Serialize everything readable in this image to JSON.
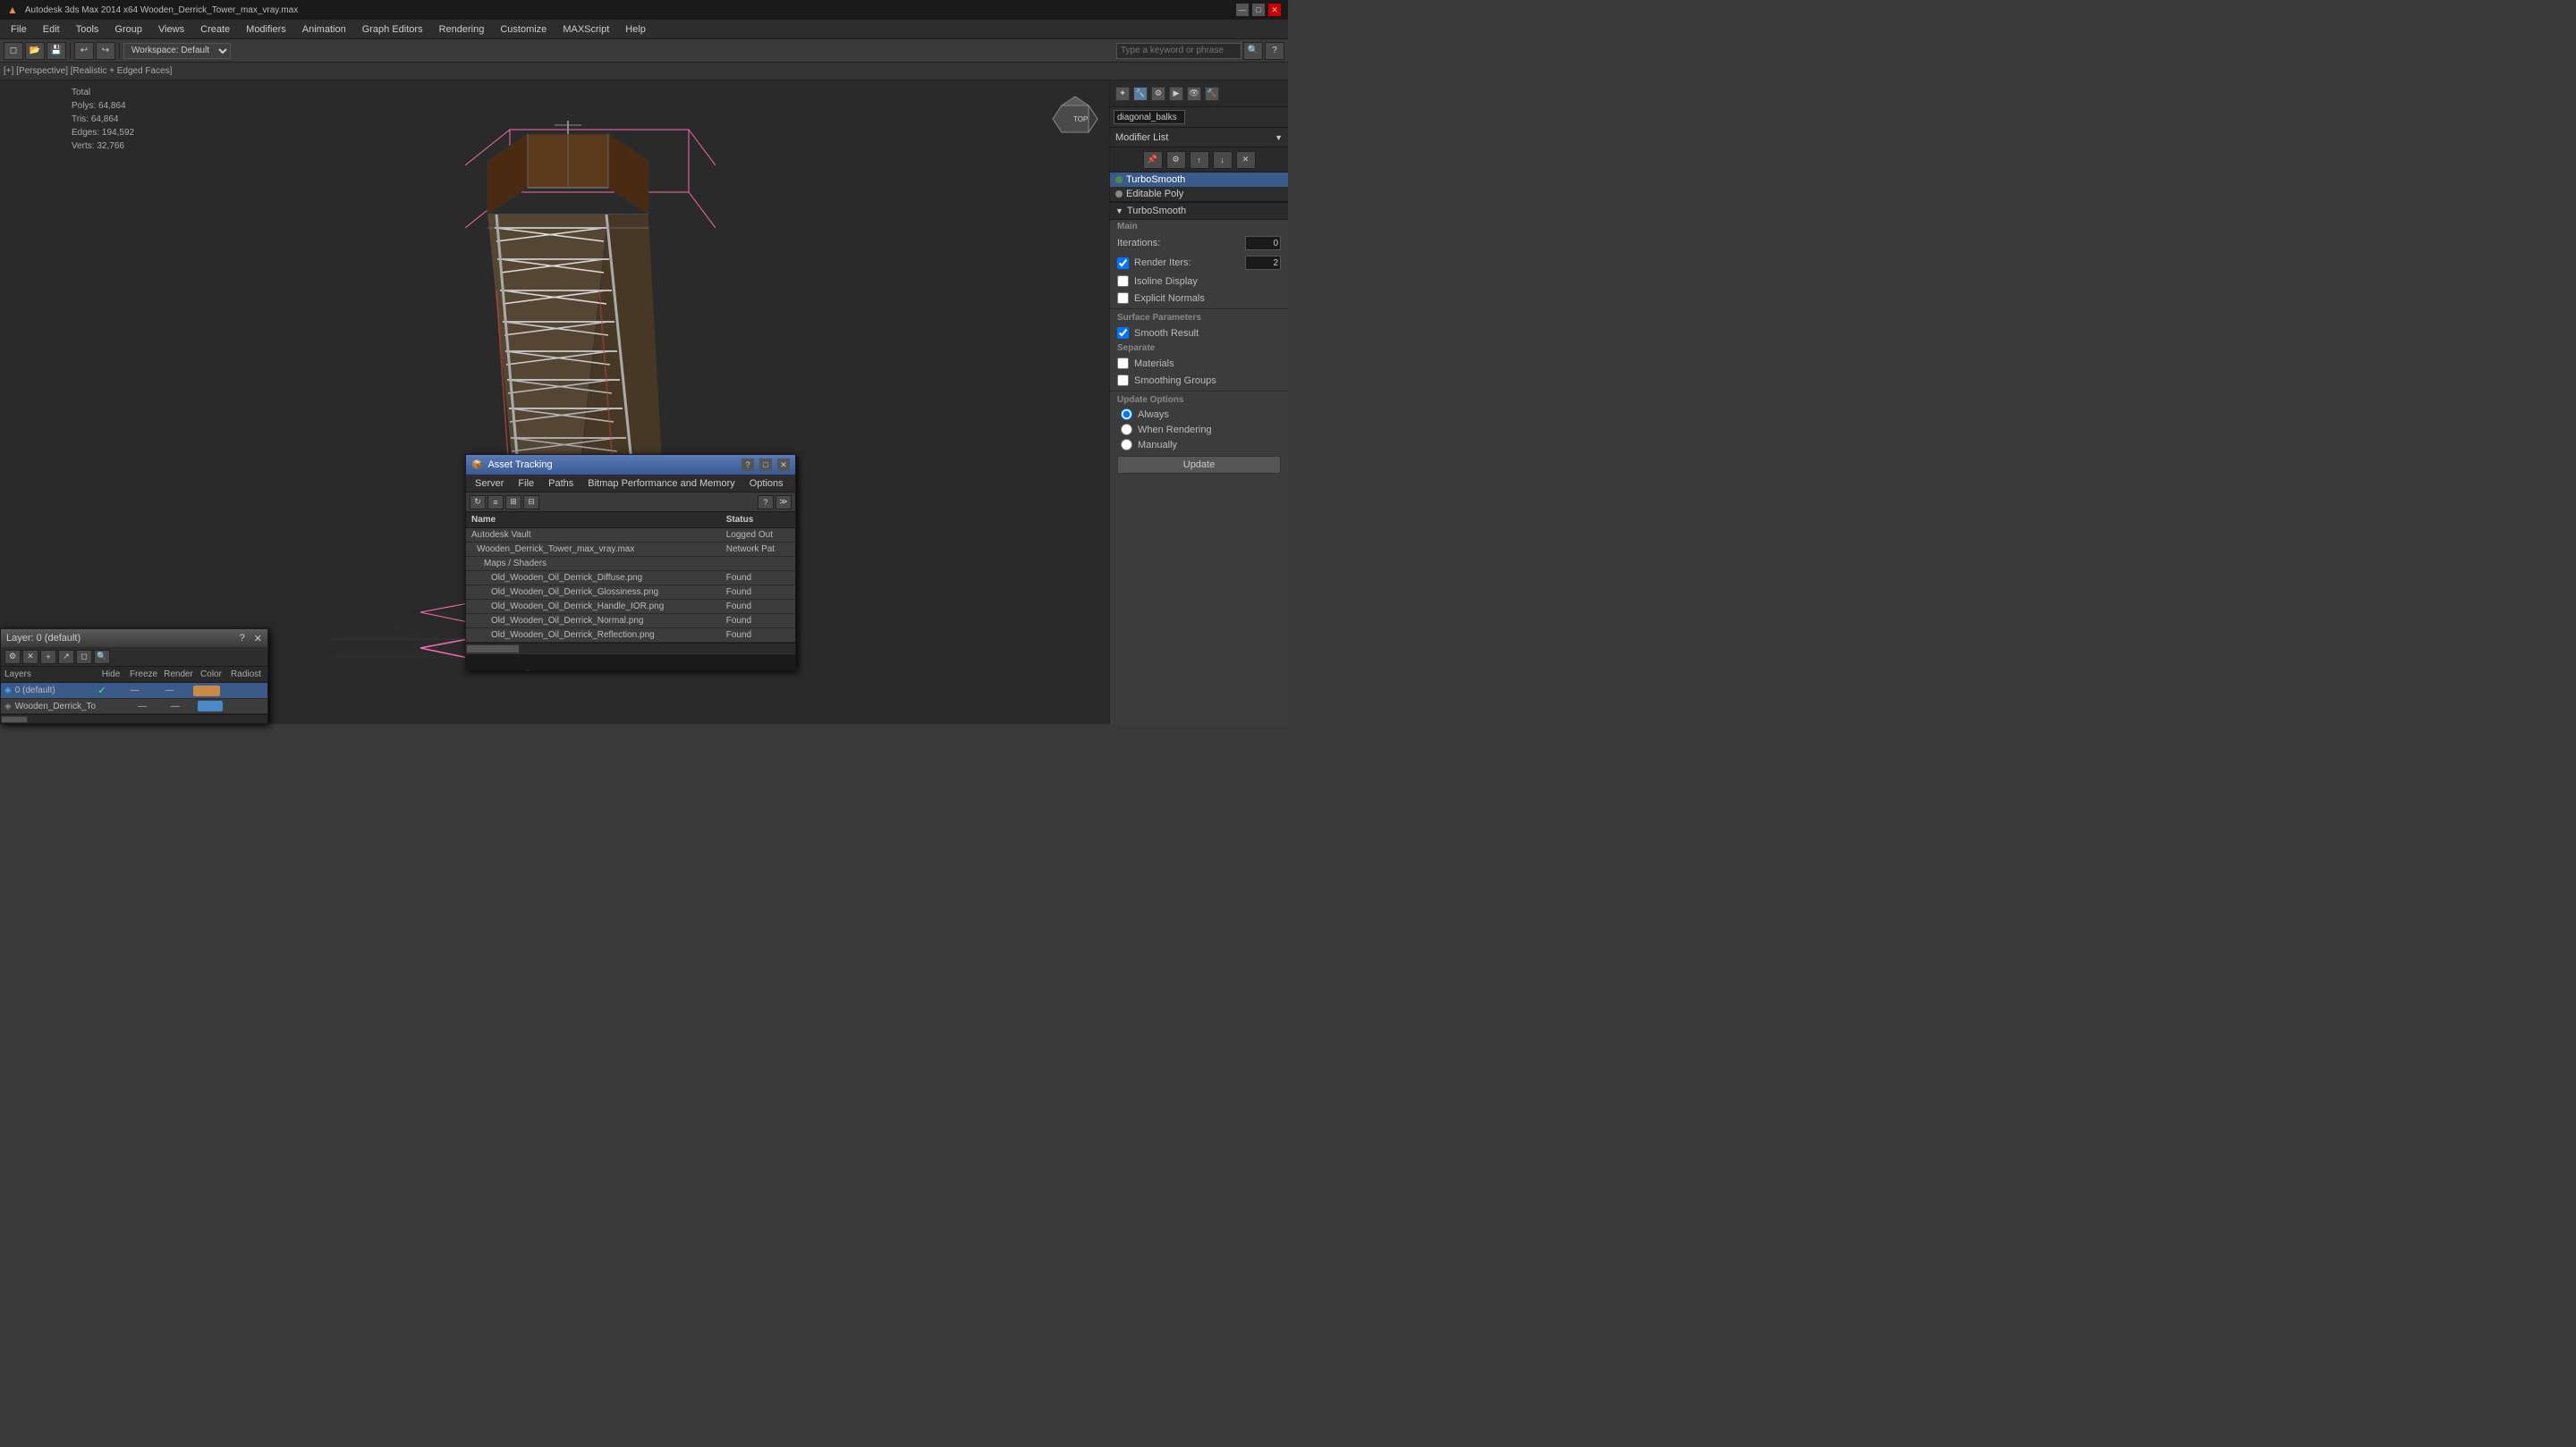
{
  "titlebar": {
    "app_icon": "3dsmax-icon",
    "title": "Autodesk 3ds Max 2014 x64  Wooden_Derrick_Tower_max_vray.max",
    "minimize_label": "—",
    "maximize_label": "□",
    "close_label": "✕"
  },
  "menubar": {
    "items": [
      "File",
      "Edit",
      "Tools",
      "Group",
      "Views",
      "Create",
      "Modifiers",
      "Animation",
      "Graph Editors",
      "Rendering",
      "Customize",
      "MAXScript",
      "Help"
    ]
  },
  "toolbar": {
    "workspace_label": "Workspace: Default",
    "search_placeholder": "Type a keyword or phrase"
  },
  "subtoolbar": {
    "breadcrumb": "[+] [Perspective] [Realistic + Edged Faces]"
  },
  "viewport": {
    "stats": {
      "total_label": "Total",
      "polys_label": "Polys:",
      "polys_value": "64,864",
      "tris_label": "Tris:",
      "tris_value": "64,864",
      "edges_label": "Edges:",
      "edges_value": "194,592",
      "verts_label": "Verts:",
      "verts_value": "32,766"
    }
  },
  "right_panel": {
    "name_field_value": "diagonal_balks",
    "modifier_list_label": "Modifier List",
    "modifiers": [
      {
        "name": "TurboSmooth",
        "active": true
      },
      {
        "name": "Editable Poly",
        "active": false
      }
    ],
    "turbosmooth": {
      "section_label": "TurboSmooth",
      "main_label": "Main",
      "iterations_label": "Iterations:",
      "iterations_value": "0",
      "render_iters_label": "Render Iters:",
      "render_iters_value": "2",
      "isoline_display_label": "Isoline Display",
      "explicit_normals_label": "Explicit Normals",
      "surface_params_label": "Surface Parameters",
      "smooth_result_label": "Smooth Result",
      "separate_label": "Separate",
      "materials_label": "Materials",
      "smoothing_groups_label": "Smoothing Groups",
      "update_options_label": "Update Options",
      "always_label": "Always",
      "when_rendering_label": "When Rendering",
      "manually_label": "Manually",
      "update_button_label": "Update"
    }
  },
  "asset_tracking": {
    "title": "Asset Tracking",
    "menu_items": [
      "Server",
      "File",
      "Paths",
      "Bitmap Performance and Memory",
      "Options"
    ],
    "col_name": "Name",
    "col_status": "Status",
    "items": [
      {
        "indent": 0,
        "icon": "vault-icon",
        "name": "Autodesk Vault",
        "status": "Logged Out",
        "status_class": "at-status-loggedout"
      },
      {
        "indent": 1,
        "icon": "file-icon",
        "name": "Wooden_Derrick_Tower_max_vray.max",
        "status": "Network Pat",
        "status_class": "at-status-networkpath"
      },
      {
        "indent": 2,
        "icon": "folder-icon",
        "name": "Maps / Shaders",
        "status": "",
        "status_class": ""
      },
      {
        "indent": 3,
        "icon": "img-icon",
        "name": "Old_Wooden_Oil_Derrick_Diffuse.png",
        "status": "Found",
        "status_class": "at-status-found"
      },
      {
        "indent": 3,
        "icon": "img-icon",
        "name": "Old_Wooden_Oil_Derrick_Glossiness.png",
        "status": "Found",
        "status_class": "at-status-found"
      },
      {
        "indent": 3,
        "icon": "img-icon",
        "name": "Old_Wooden_Oil_Derrick_Handle_IOR.png",
        "status": "Found",
        "status_class": "at-status-found"
      },
      {
        "indent": 3,
        "icon": "img-icon",
        "name": "Old_Wooden_Oil_Derrick_Normal.png",
        "status": "Found",
        "status_class": "at-status-found"
      },
      {
        "indent": 3,
        "icon": "img-icon",
        "name": "Old_Wooden_Oil_Derrick_Reflection.png",
        "status": "Found",
        "status_class": "at-status-found"
      }
    ]
  },
  "layers_panel": {
    "title": "Layer: 0 (default)",
    "question_label": "?",
    "close_label": "✕",
    "col_headers": [
      "",
      "Hide",
      "Freeze",
      "Render",
      "Color",
      "Radiost"
    ],
    "layers": [
      {
        "name": "0 (default)",
        "active": true,
        "checkmark": "✓"
      },
      {
        "name": "Wooden_Derrick_To",
        "active": false,
        "checkmark": ""
      }
    ],
    "section_label": "Layers"
  }
}
